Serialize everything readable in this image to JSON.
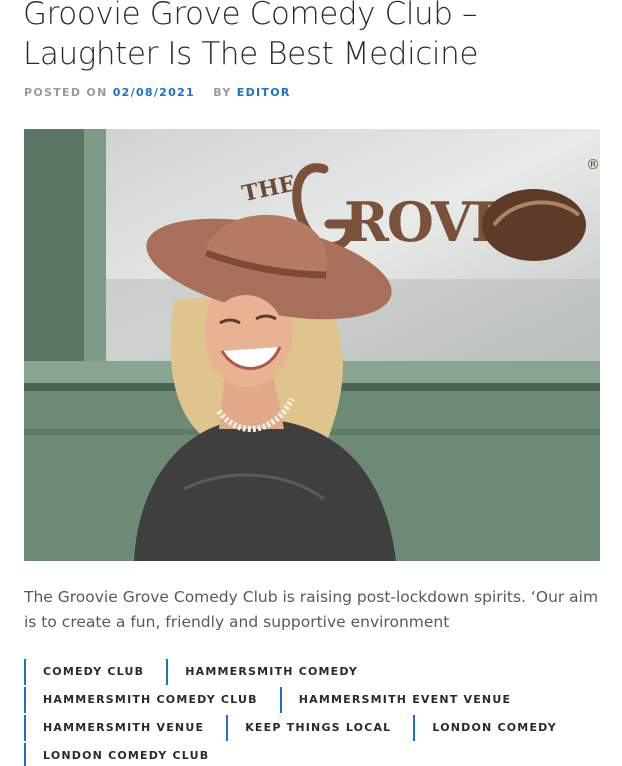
{
  "post": {
    "title": "Groovie Grove Comedy Club – Laughter Is The Best Medicine",
    "meta": {
      "posted_on_label": "POSTED ON",
      "date": "02/08/2021",
      "by_label": "BY",
      "author": "EDITOR"
    },
    "image": {
      "sign_text": "THE GROVE",
      "registered_mark": "®"
    },
    "excerpt": "The Groovie Grove Comedy Club is raising post-lockdown spirits. ‘Our aim is to create a fun, friendly and supportive environment",
    "tags": [
      "COMEDY CLUB",
      "HAMMERSMITH COMEDY",
      "HAMMERSMITH COMEDY CLUB",
      "HAMMERSMITH EVENT VENUE",
      "HAMMERSMITH VENUE",
      "KEEP THINGS LOCAL",
      "LONDON COMEDY",
      "LONDON COMEDY CLUB"
    ]
  },
  "colors": {
    "accent": "#1a6fd1",
    "meta_gray": "#9a9a9a",
    "title_text": "#2a2a2a",
    "body_text": "#5a5a5a"
  }
}
